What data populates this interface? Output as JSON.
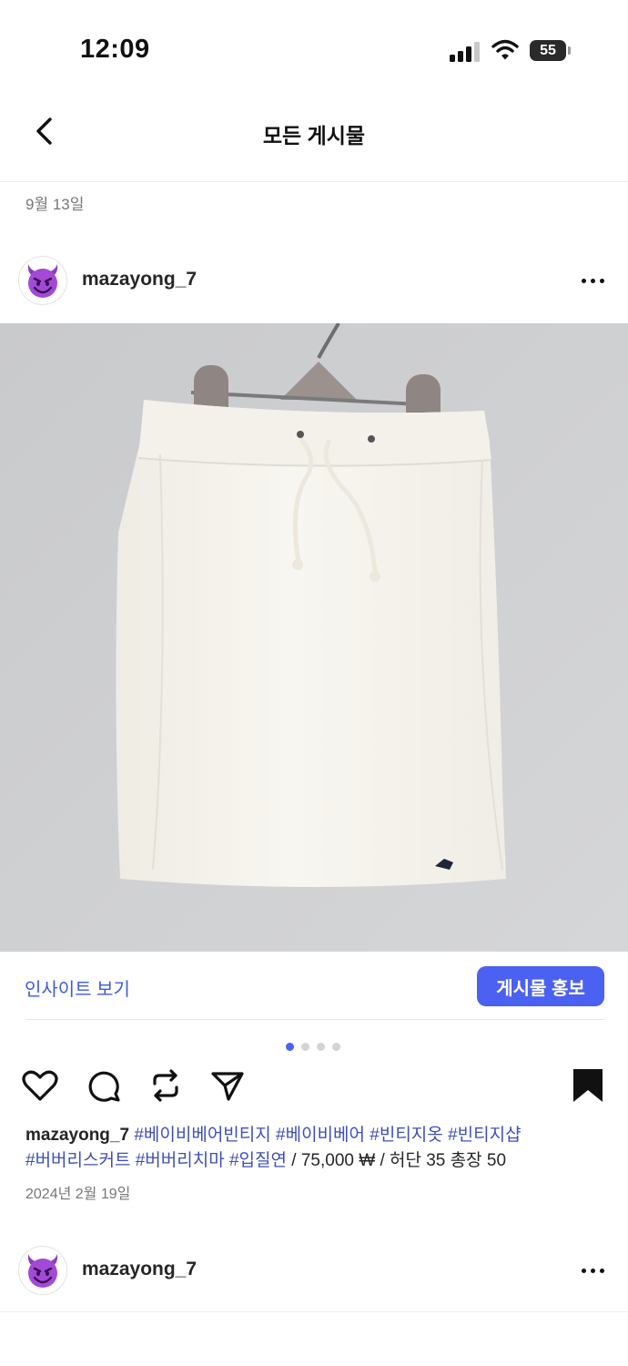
{
  "status_bar": {
    "time": "12:09",
    "battery": "55"
  },
  "nav": {
    "title": "모든 게시물"
  },
  "date_header": "9월 13일",
  "post": {
    "username": "mazayong_7",
    "insights_label": "인사이트 보기",
    "promote_label": "게시물 홍보",
    "carousel": {
      "count": 4,
      "active_index": 0
    },
    "caption": {
      "username": "mazayong_7",
      "hashtags": [
        "#베이비베어빈티지",
        "#베이비베어",
        "#빈티지옷",
        "#빈티지샵",
        "#버버리스커트",
        "#버버리치마",
        "#입질연"
      ],
      "suffix": " / 75,000 ₩ / 허단 35 총장 50"
    },
    "date": "2024년 2월 19일"
  },
  "next_post": {
    "username": "mazayong_7"
  },
  "icons": {
    "back": "chevron-left-icon",
    "more": "more-horizontal-icon",
    "like": "heart-icon",
    "comment": "comment-icon",
    "repost": "repost-icon",
    "share": "send-icon",
    "save": "bookmark-icon",
    "avatar": "smiling-devil-emoji"
  },
  "colors": {
    "accent": "#4a61f1",
    "hashtag": "#3d4fb8",
    "muted": "#777777"
  }
}
